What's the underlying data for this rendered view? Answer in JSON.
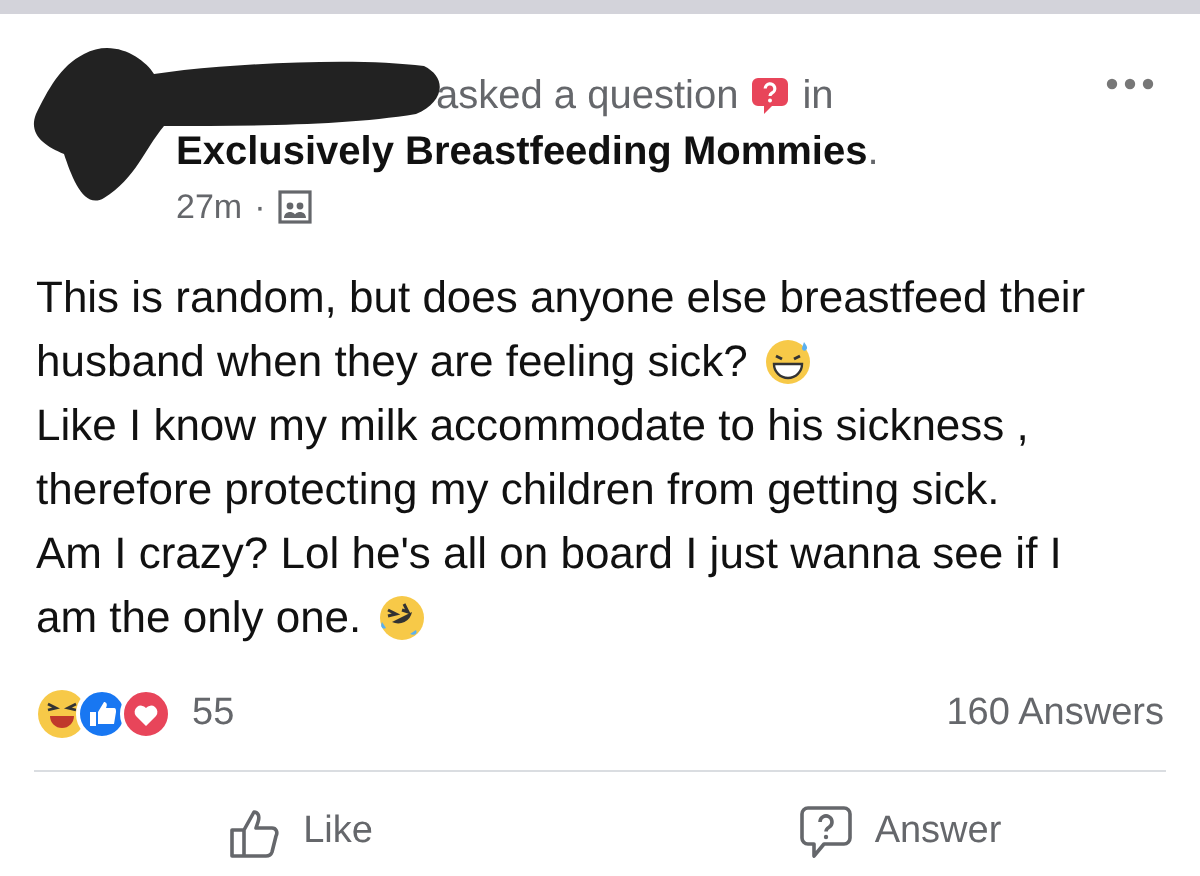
{
  "post": {
    "action": "asked a question",
    "preposition": "in",
    "group": "Exclusively Breastfeeding Mommies",
    "group_suffix": ".",
    "time": "27m",
    "separator": "·",
    "body_lines": [
      {
        "text": "This is random, but does anyone else breastfeed their"
      },
      {
        "text": "husband when they are feeling sick?",
        "emoji": {
          "kind": "sweat-smile"
        }
      },
      {
        "text": "Like I know my milk accommodate to his sickness ,"
      },
      {
        "text": "therefore protecting my children from getting sick."
      },
      {
        "text": "Am I crazy? Lol he's all on board I just wanna see if I"
      },
      {
        "text": "am the only one.",
        "emoji": {
          "kind": "rofl"
        }
      }
    ],
    "reaction_count": "55",
    "answers": "160 Answers"
  },
  "actions": [
    {
      "label": "Like",
      "kind": "like"
    },
    {
      "label": "Answer",
      "kind": "answer"
    }
  ]
}
